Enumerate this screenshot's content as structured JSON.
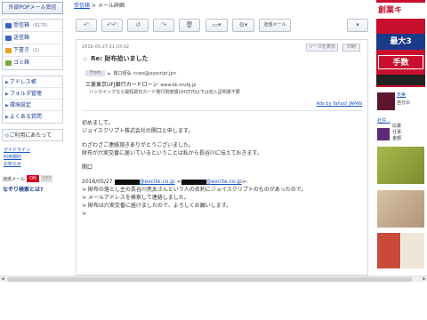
{
  "sidebar": {
    "pop_button": "外部POPメール受信",
    "folders": [
      {
        "label": "受信箱",
        "count": "(9175)",
        "icon": "inbox-icon",
        "color": "#3a63c8"
      },
      {
        "label": "送信箱",
        "count": "",
        "icon": "sent-icon",
        "color": "#3a63c8"
      },
      {
        "label": "下書き",
        "count": "(1)",
        "icon": "drafts-icon",
        "color": "#e6a21a"
      },
      {
        "label": "ゴミ箱",
        "count": "",
        "icon": "trash-icon",
        "color": "#7aa83a"
      }
    ],
    "menus": [
      "アドレス帳",
      "フォルダ管理",
      "環境設定",
      "よくある質問"
    ],
    "notice": "ご利用にあたって",
    "links": [
      "ガイドライン",
      "利用規約",
      "お知らせ"
    ],
    "toggle_label": "迷惑メール",
    "toggle_on": "ON",
    "toggle_off": "OFF",
    "search_link": "なぞり検索とは?"
  },
  "breadcrumb": {
    "inbox": "受信箱",
    "sep": " > ",
    "current": "メール詳細"
  },
  "toolbar": {
    "reply_label": "↶",
    "reply_all_label": "↶↶",
    "undo_label": "↺",
    "forward_label": "↷",
    "delete_label": "🗑",
    "move_label": "▭▾",
    "settings_label": "⚙▾",
    "spam_label": "迷惑メール",
    "more_label": "▾"
  },
  "mail": {
    "date": "2016-05-27 21:03:02",
    "show_source": "ソースを表示",
    "print": "印刷",
    "subject": "Re: 財布拾いました",
    "from_label": "From",
    "sender": "関口昭弘 <ceo@joyscript.jp>",
    "ad_title": "三菱東京UFJ銀行カードローン",
    "ad_url": "www.bk.mufg.jp",
    "ad_text": "バンクイックなら最短即日カード発行限度額100万円以下は収入証明書不要",
    "ads_by": "Ads by Yahoo! JAPAN",
    "body_lines": [
      "初めまして。",
      "ジョイスクリプト株式会社の関口と申します。",
      "",
      "わざわざご連絡頂きありがとうございました。",
      "財布が六実交番に届いているということは私から長谷川に伝えておきます。",
      "",
      "関口",
      ""
    ],
    "quote_prefix": "2016/05/27 ",
    "quote_domain1": "@excite.co.jp",
    "quote_mid": " <",
    "quote_domain2": "@excite.co.jp",
    "quote_suffix": ">:",
    "quote_lines": [
      "> 財布の落とし主の長谷川亮太さんという人の名刺にジョイスクリプトのものがあったので。",
      "> メールアドレスを検索して連絡しました。",
      "> 財布は六実交番に届けましたので、よろしくお願いします。",
      ">"
    ]
  },
  "ads": {
    "banner_line1": "創業キ",
    "banner_line2": "最大3",
    "banner_line3": "手数",
    "ad_mid_title": "天美",
    "ad_mid_sub": "自分の",
    "ad_mid2_title": "社労...",
    "ad_mid2_rows": [
      "応募",
      "仕事",
      "金額"
    ]
  }
}
